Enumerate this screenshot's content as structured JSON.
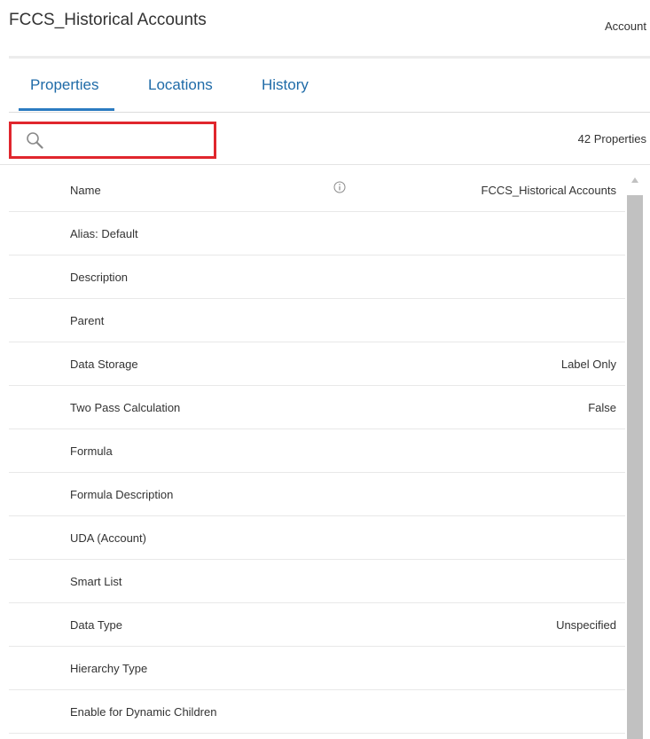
{
  "header": {
    "title": "FCCS_Historical Accounts",
    "object_type": "Account"
  },
  "tabs": [
    {
      "label": "Properties",
      "active": true
    },
    {
      "label": "Locations",
      "active": false
    },
    {
      "label": "History",
      "active": false
    }
  ],
  "search": {
    "placeholder": "",
    "value": "",
    "count_label": "42 Properties"
  },
  "properties": [
    {
      "name": "Name",
      "value": "FCCS_Historical Accounts",
      "has_info_icon": true
    },
    {
      "name": "Alias: Default",
      "value": ""
    },
    {
      "name": "Description",
      "value": ""
    },
    {
      "name": "Parent",
      "value": ""
    },
    {
      "name": "Data Storage",
      "value": "Label Only"
    },
    {
      "name": "Two Pass Calculation",
      "value": "False"
    },
    {
      "name": "Formula",
      "value": ""
    },
    {
      "name": "Formula Description",
      "value": ""
    },
    {
      "name": "UDA (Account)",
      "value": ""
    },
    {
      "name": "Smart List",
      "value": ""
    },
    {
      "name": "Data Type",
      "value": "Unspecified"
    },
    {
      "name": "Hierarchy Type",
      "value": ""
    },
    {
      "name": "Enable for Dynamic Children",
      "value": ""
    }
  ],
  "colors": {
    "tab_text": "#1f6ba8",
    "tab_underline": "#2b7bc1",
    "highlight_border": "#e0262d",
    "scrollbar": "#c1c1c1"
  },
  "icons": {
    "search": "search-icon",
    "info": "info-icon",
    "scroll_up": "chevron-up-icon"
  }
}
